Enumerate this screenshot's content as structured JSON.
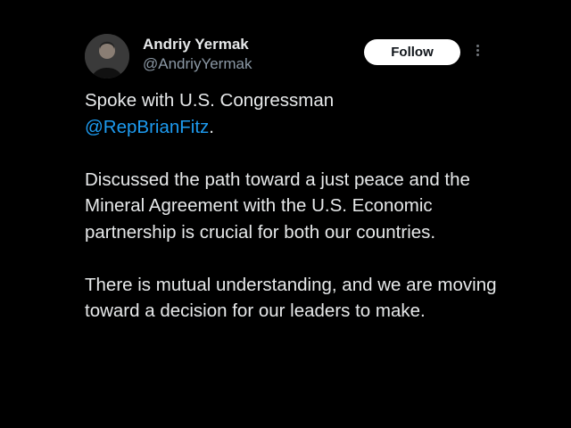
{
  "author": {
    "name": "Andriy Yermak",
    "handle": "@AndriyYermak"
  },
  "actions": {
    "follow_label": "Follow",
    "more_icon": "more-vertical-icon"
  },
  "tweet": {
    "p1_text": "Spoke with U.S. Congressman",
    "p1_mention": "@RepBrianFitz",
    "p1_after": ".",
    "p2": "Discussed the path toward a just peace and the Mineral Agreement with the U.S. Economic partnership is crucial for both our countries.",
    "p3": "There is mutual understanding, and we are moving toward a decision for our leaders to make."
  },
  "colors": {
    "background": "#000000",
    "text": "#e7e9ea",
    "secondary": "#8b98a5",
    "link": "#1d9bf0",
    "button_bg": "#ffffff"
  }
}
